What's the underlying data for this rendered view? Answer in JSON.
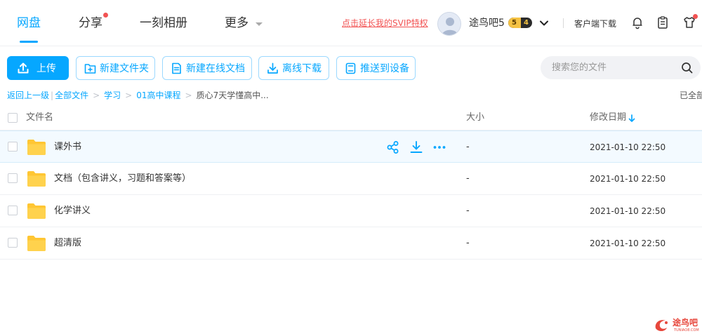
{
  "nav": {
    "tabs": [
      {
        "label": "网盘",
        "active": true
      },
      {
        "label": "分享",
        "dot": true
      },
      {
        "label": "一刻相册"
      },
      {
        "label": "更多"
      }
    ]
  },
  "header": {
    "promo": "点击延长我的SVIP特权",
    "username": "途鸟吧5",
    "vip_level": "5",
    "vip_extra": "4",
    "client_download": "客户端下载",
    "icons": [
      "bell-icon",
      "clipboard-icon",
      "shirt-icon"
    ]
  },
  "toolbar": {
    "upload": "上传",
    "new_folder": "新建文件夹",
    "new_online_doc": "新建在线文档",
    "offline_download": "离线下载",
    "push_device": "推送到设备"
  },
  "search": {
    "placeholder": "搜索您的文件"
  },
  "breadcrumb": {
    "back": "返回上一级",
    "items": [
      "全部文件",
      "学习",
      "01高中课程"
    ],
    "current": "质心7天学懂高中...",
    "loaded": "已全部"
  },
  "table": {
    "headers": {
      "name": "文件名",
      "size": "大小",
      "modified": "修改日期"
    },
    "rows": [
      {
        "name": "课外书",
        "size": "-",
        "modified": "2021-01-10 22:50",
        "hover": true
      },
      {
        "name": "文档（包含讲义，习题和答案等）",
        "size": "-",
        "modified": "2021-01-10 22:50"
      },
      {
        "name": "化学讲义",
        "size": "-",
        "modified": "2021-01-10 22:50"
      },
      {
        "name": "超清版",
        "size": "-",
        "modified": "2021-01-10 22:50"
      }
    ]
  },
  "watermark": {
    "name": "途鸟吧",
    "sub": "TUNIAO8.COM"
  },
  "colors": {
    "accent": "#06a7ff",
    "promo": "#f25353",
    "folder": "#ffc633",
    "hover_row": "#f3faff"
  }
}
